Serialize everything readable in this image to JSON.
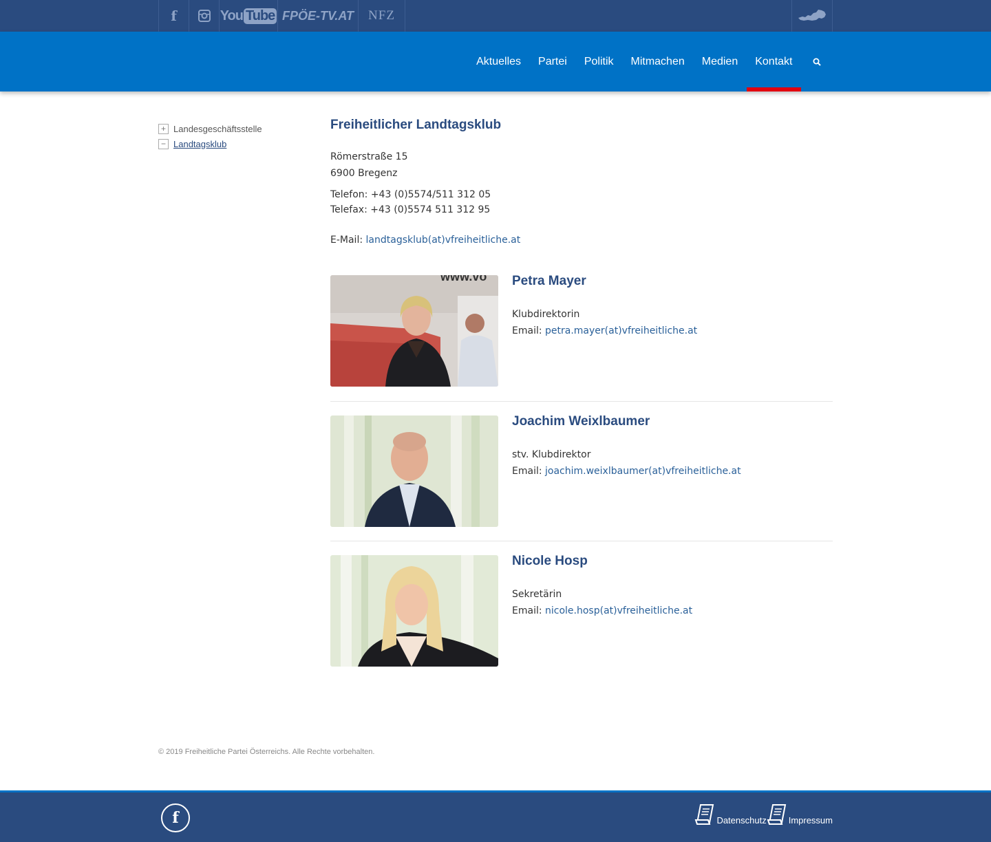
{
  "topbar": {
    "social": [
      {
        "name": "facebook",
        "icon": "facebook-icon"
      },
      {
        "name": "instagram",
        "icon": "instagram-icon"
      },
      {
        "name": "youtube",
        "label_you": "You",
        "label_tube": "Tube"
      },
      {
        "name": "fpoe-tv",
        "label": "FPÖE-TV.AT"
      },
      {
        "name": "nfz",
        "label": "NFZ"
      }
    ],
    "austria_icon": "austria-map-icon"
  },
  "nav": {
    "items": [
      "Aktuelles",
      "Partei",
      "Politik",
      "Mitmachen",
      "Medien",
      "Kontakt"
    ],
    "active": "Kontakt",
    "search_icon": "search-icon"
  },
  "sidebar": {
    "items": [
      {
        "label": "Landesgeschäftsstelle",
        "toggle": "+"
      },
      {
        "label": "Landtagsklub",
        "toggle": "−"
      }
    ]
  },
  "main": {
    "title": "Freiheitlicher Landtagsklub",
    "street": "Römerstraße 15",
    "city": "6900 Bregenz",
    "phone": "Telefon: +43 (0)5574/511 312 05",
    "fax": "Telefax: +43 (0)5574 511 312 95",
    "email_label": "E-Mail:",
    "email": "landtagsklub(at)vfreiheitliche.at",
    "persons": [
      {
        "name": "Petra Mayer",
        "role": "Klubdirektorin",
        "email_label": "Email:",
        "email": "petra.mayer(at)vfreiheitliche.at"
      },
      {
        "name": "Joachim Weixlbaumer",
        "role": "stv. Klubdirektor",
        "email_label": "Email:",
        "email": "joachim.weixlbaumer(at)vfreiheitliche.at"
      },
      {
        "name": "Nicole Hosp",
        "role": "Sekretärin",
        "email_label": "Email:",
        "email": "nicole.hosp(at)vfreiheitliche.at"
      }
    ]
  },
  "copyright": "© 2019 Freiheitliche Partei Österreichs. Alle Rechte vorbehalten.",
  "footer": {
    "datenschutz": "Datenschutz",
    "impressum": "Impressum"
  },
  "colors": {
    "topbar": "#2a4b7f",
    "navbar": "#0072c6",
    "active_underline": "#e3000f",
    "heading": "#2a4b7f",
    "link": "#2a6099"
  }
}
